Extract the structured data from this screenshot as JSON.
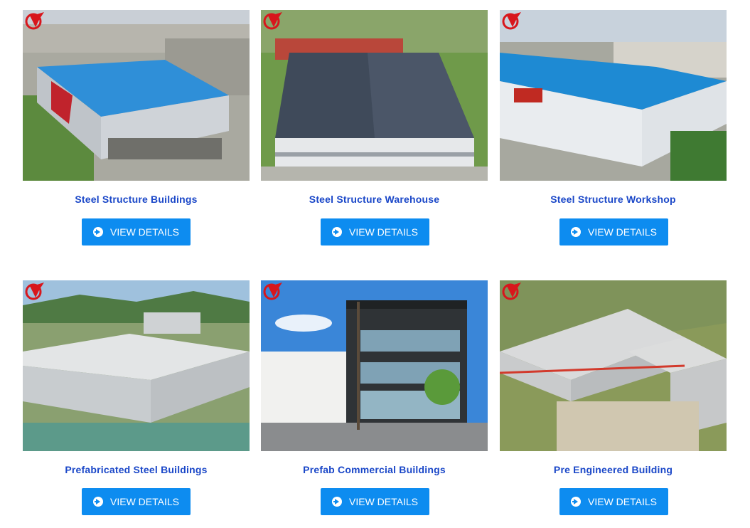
{
  "products": [
    {
      "title": "Steel Structure Buildings",
      "button": "VIEW DETAILS",
      "image": "blue-roof-steel-building-aerial"
    },
    {
      "title": "Steel Structure Warehouse",
      "button": "VIEW DETAILS",
      "image": "solar-panel-roof-warehouse-aerial"
    },
    {
      "title": "Steel Structure Workshop",
      "button": "VIEW DETAILS",
      "image": "blue-roof-workshop-aerial"
    },
    {
      "title": "Prefabricated Steel Buildings",
      "button": "VIEW DETAILS",
      "image": "white-roof-prefab-building-hills"
    },
    {
      "title": "Prefab Commercial Buildings",
      "button": "VIEW DETAILS",
      "image": "modern-commercial-building-street"
    },
    {
      "title": "Pre Engineered Building",
      "button": "VIEW DETAILS",
      "image": "grey-roof-red-trim-building-aerial"
    }
  ],
  "icons": {
    "button_icon": "arrow-circle-right-icon",
    "logo": "brand-logo-mark"
  }
}
